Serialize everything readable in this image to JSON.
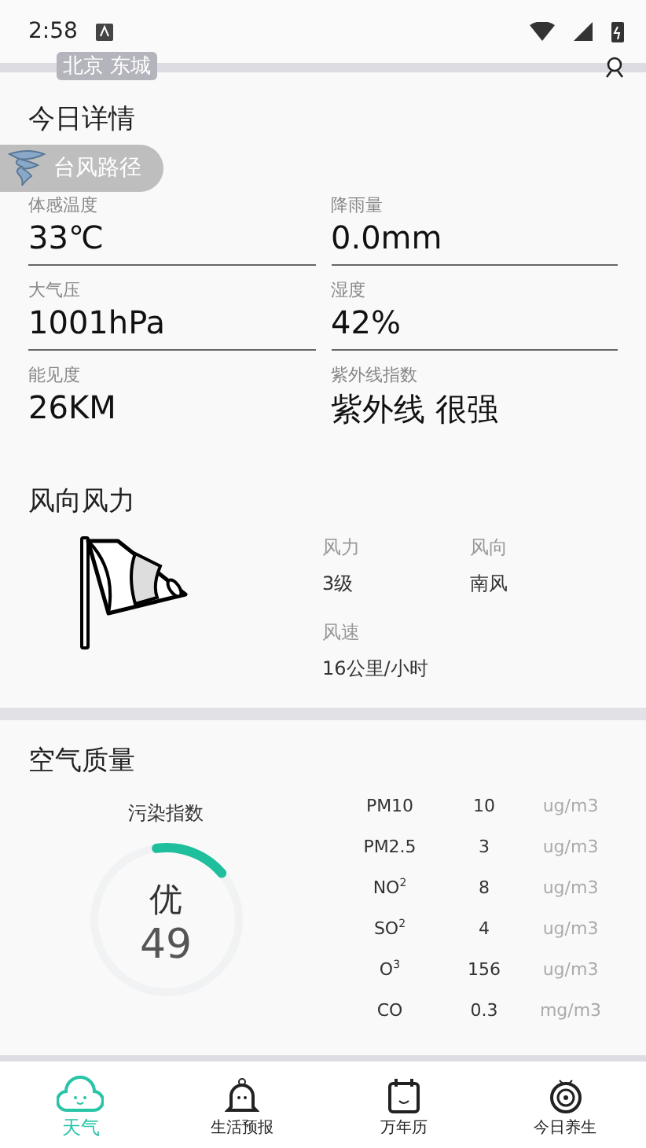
{
  "status_bar": {
    "time": "2:58"
  },
  "header": {
    "location": "北京 东城"
  },
  "typhoon_button": {
    "label": "台风路径"
  },
  "today": {
    "title": "今日详情",
    "items": [
      {
        "label": "体感温度",
        "value": "33℃"
      },
      {
        "label": "降雨量",
        "value": "0.0mm"
      },
      {
        "label": "大气压",
        "value": "1001hPa"
      },
      {
        "label": "湿度",
        "value": "42%"
      },
      {
        "label": "能见度",
        "value": "26KM"
      },
      {
        "label": "紫外线指数",
        "value": "紫外线 很强"
      }
    ]
  },
  "wind": {
    "title": "风向风力",
    "items": [
      {
        "label": "风力",
        "value": "3级"
      },
      {
        "label": "风向",
        "value": "南风"
      },
      {
        "label": "风速",
        "value": "16公里/小时"
      }
    ]
  },
  "air": {
    "title": "空气质量",
    "index_label": "污染指数",
    "grade": "优",
    "aqi": "49",
    "level": 0.16,
    "pollutants": [
      {
        "name": "PM10",
        "value": "10",
        "unit": "ug/m3"
      },
      {
        "name": "PM2.5",
        "value": "3",
        "unit": "ug/m3"
      },
      {
        "name": "NO$^{2}$",
        "value": "8",
        "unit": "ug/m3"
      },
      {
        "name": "SO$^{2}$",
        "value": "4",
        "unit": "ug/m3"
      },
      {
        "name": "O$^{3}$",
        "value": "156",
        "unit": "ug/m3"
      },
      {
        "name": "CO",
        "value": "0.3",
        "unit": "mg/m3"
      }
    ]
  },
  "tabs": [
    {
      "label": "天气",
      "kind": "cloud",
      "selected": true
    },
    {
      "label": "生活预报",
      "kind": "bell",
      "selected": false
    },
    {
      "label": "万年历",
      "kind": "calendar",
      "selected": false
    },
    {
      "label": "今日养生",
      "kind": "radar",
      "selected": false
    }
  ]
}
